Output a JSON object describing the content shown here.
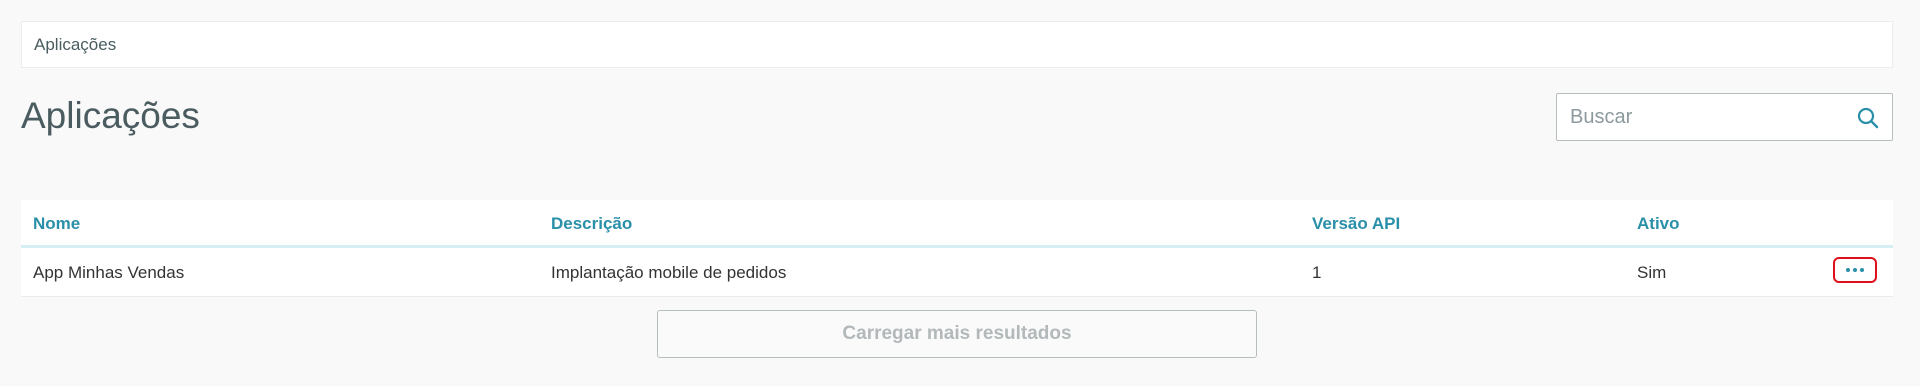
{
  "breadcrumb": {
    "label": "Aplicações"
  },
  "page": {
    "title": "Aplicações"
  },
  "search": {
    "placeholder": "Buscar",
    "value": ""
  },
  "table": {
    "columns": [
      "Nome",
      "Descrição",
      "Versão API",
      "Ativo"
    ],
    "rows": [
      {
        "nome": "App Minhas Vendas",
        "descricao": "Implantação mobile de pedidos",
        "versao_api": "1",
        "ativo": "Sim",
        "actions_icon": "more-horizontal-icon"
      }
    ]
  },
  "load_more": {
    "label": "Carregar mais resultados"
  },
  "colors": {
    "accent": "#2a8fa8",
    "highlight": "#e0101a",
    "background": "#f9f9f9"
  }
}
